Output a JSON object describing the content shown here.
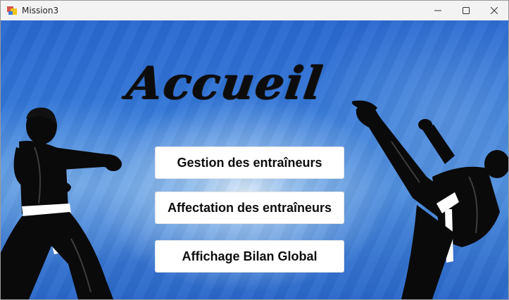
{
  "window": {
    "title": "Mission3",
    "controls": {
      "minimize_icon": "minimize-icon",
      "maximize_icon": "maximize-icon",
      "close_icon": "close-icon"
    }
  },
  "main": {
    "heading": "Accueil",
    "buttons": [
      {
        "label": "Gestion des entraîneurs"
      },
      {
        "label": "Affectation des entraîneurs"
      },
      {
        "label": "Affichage Bilan Global"
      }
    ]
  },
  "colors": {
    "background_blue": "#3478d8",
    "button_bg": "#ffffff",
    "text_dark": "#0d0d0d"
  }
}
